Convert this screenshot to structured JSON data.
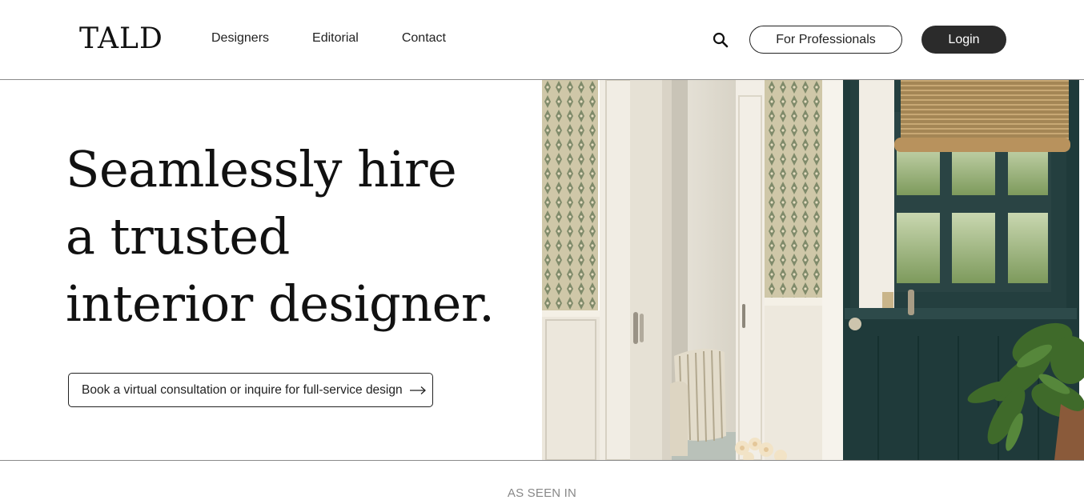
{
  "header": {
    "logo": "TALD",
    "nav": [
      "Designers",
      "Editorial",
      "Contact"
    ],
    "search_icon": "search-icon",
    "for_professionals_label": "For Professionals",
    "login_label": "Login"
  },
  "hero": {
    "headline_lines": [
      "Seamlessly hire",
      "a trusted",
      "interior designer."
    ],
    "cta_label": "Book a virtual consultation or inquire for full-service design",
    "cta_icon": "arrow-right-icon",
    "image_subject": "entryway with patterned wallpaper, white cabinetry, striped cushion bench, dark green dutch door with window and hanging fern"
  },
  "as_seen_in": "AS SEEN IN",
  "colors": {
    "text": "#1a1a1a",
    "login_bg": "#2b2b2b",
    "door_green": "#1f3a3a",
    "divider": "#8a8a8a",
    "muted": "#888888"
  }
}
